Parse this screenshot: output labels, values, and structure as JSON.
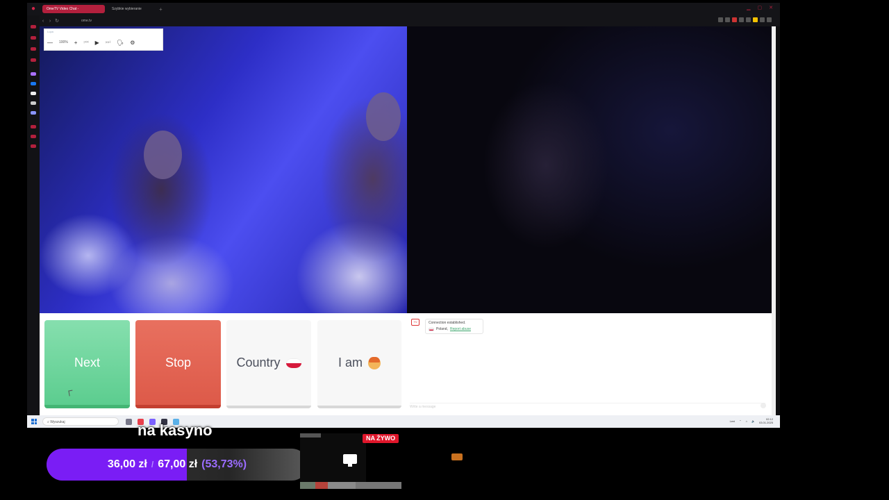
{
  "browser": {
    "tabs": [
      {
        "label": "OmeTV Video Chat -",
        "active": true
      },
      {
        "label": "Szybkie wybieranie",
        "active": false
      }
    ],
    "url": "ome.tv"
  },
  "mini_toolbar": {
    "title": "Lupa",
    "zoom": "100%"
  },
  "controls": {
    "next_label": "Next",
    "stop_label": "Stop",
    "country_label": "Country",
    "i_am_label": "I am"
  },
  "chat": {
    "status_line": "Connection established.",
    "country": "Poland,",
    "report_link": "Report abuse",
    "input_placeholder": "Write a message"
  },
  "taskbar": {
    "search_placeholder": "Wyszukaj",
    "weather": "Leni",
    "time": "02:12",
    "date": "03.01.2025"
  },
  "stream_overlay": {
    "caption": "na kasyno",
    "goal": {
      "current": "36,00 zł",
      "separator": "/",
      "target": "67,00 zł",
      "percent_text": "(53,73%)",
      "progress": 0.5373
    },
    "live_badge": "NA ŻYWO"
  },
  "colors": {
    "accent_red": "#b3203d",
    "next_green": "#5ccd8f",
    "stop_red": "#dd5a49",
    "goal_purple": "#7a1df5"
  }
}
